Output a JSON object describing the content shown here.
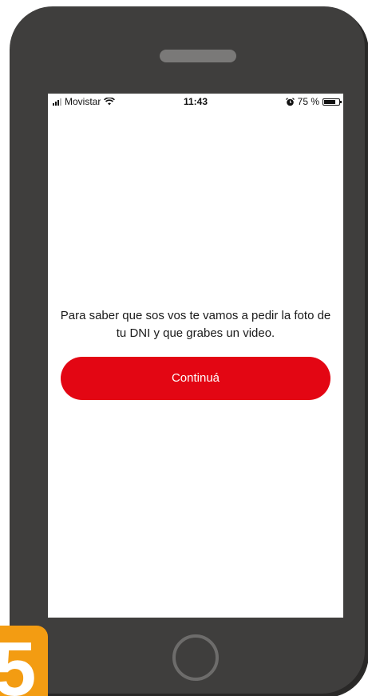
{
  "status_bar": {
    "carrier": "Movistar",
    "time": "11:43",
    "battery_percent": "75 %",
    "battery_level": 0.75,
    "icons": [
      "signal-icon",
      "wifi-icon",
      "alarm-icon",
      "battery-icon"
    ]
  },
  "main": {
    "message": "Para saber que sos vos te vamos a pedir la foto de tu DNI y que grabes un video.",
    "continue_label": "Continuá"
  },
  "step_badge": {
    "number": "5"
  },
  "colors": {
    "accent": "#e30613",
    "phone_body": "#3f3e3d",
    "badge": "#f39c12"
  }
}
